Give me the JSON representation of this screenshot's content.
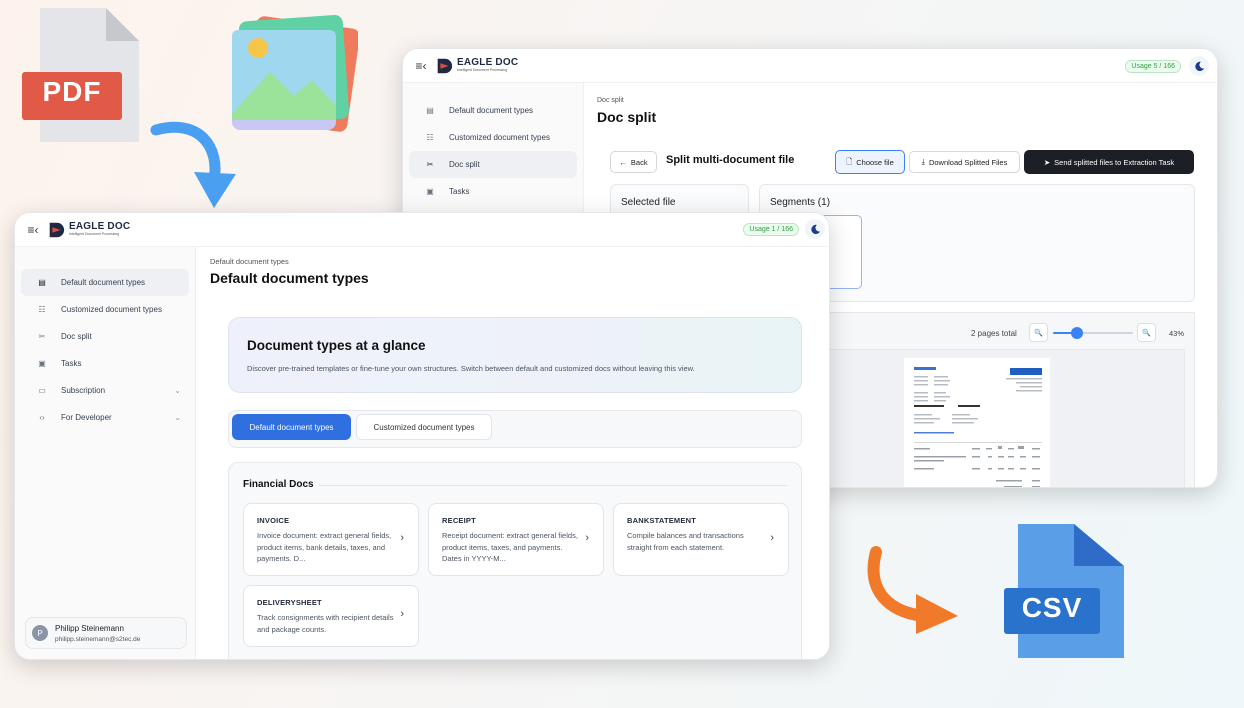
{
  "decor": {
    "pdf_label": "PDF",
    "csv_label": "CSV"
  },
  "back_window": {
    "logo_title": "EAGLE DOC",
    "logo_subtitle": "Intelligent Document Processing",
    "usage": "Usage 5 / 166",
    "sidebar": [
      {
        "label": "Default document types",
        "icon": "document-stack-icon"
      },
      {
        "label": "Customized document types",
        "icon": "sliders-icon"
      },
      {
        "label": "Doc split",
        "icon": "scissors-icon"
      },
      {
        "label": "Tasks",
        "icon": "clipboard-icon"
      }
    ],
    "breadcrumb": "Doc split",
    "page_title": "Doc split",
    "back_label": "Back",
    "subtitle": "Split multi-document file",
    "choose_file": "Choose file",
    "download": "Download Splitted Files",
    "send": "Send splitted files to Extraction Task",
    "selected_file": "Selected file",
    "segments": "Segments (1)",
    "pages_total": "2 pages total",
    "zoom": "43%",
    "zoom_level": 0.3
  },
  "front_window": {
    "logo_title": "EAGLE DOC",
    "logo_subtitle": "Intelligent Document Processing",
    "usage": "Usage 1 / 166",
    "sidebar": [
      {
        "label": "Default document types",
        "icon": "document-stack-icon"
      },
      {
        "label": "Customized document types",
        "icon": "sliders-icon"
      },
      {
        "label": "Doc split",
        "icon": "scissors-icon"
      },
      {
        "label": "Tasks",
        "icon": "clipboard-icon"
      },
      {
        "label": "Subscription",
        "icon": "card-icon"
      },
      {
        "label": "For Developer",
        "icon": "code-icon"
      }
    ],
    "breadcrumb": "Default document types",
    "page_title": "Default document types",
    "hero_title": "Document types at a glance",
    "hero_text": "Discover pre-trained templates or fine-tune your own structures. Switch between default and customized docs without leaving this view.",
    "tabs": [
      "Default document types",
      "Customized document types"
    ],
    "section_title": "Financial Docs",
    "cards": [
      {
        "title": "INVOICE",
        "desc": "Invoice document: extract general fields, product items, bank details, taxes, and payments. D..."
      },
      {
        "title": "RECEIPT",
        "desc": "Receipt document: extract general fields, product items, taxes, and payments. Dates in YYYY-M..."
      },
      {
        "title": "BANKSTATEMENT",
        "desc": "Compile balances and transactions straight from each statement."
      },
      {
        "title": "DELIVERYSHEET",
        "desc": "Track consignments with recipient details and package counts."
      }
    ],
    "user_name": "Philipp Steinemann",
    "user_email": "philipp.steinemann@s2tec.de",
    "user_initial": "P"
  },
  "colors": {
    "accent": "#2f6fe0",
    "dark_button": "#1c1f26",
    "pdf_red": "#e05a47",
    "csv_blue": "#2a73cc",
    "arrow_blue": "#4a9ff0",
    "arrow_orange": "#f07a2a"
  }
}
